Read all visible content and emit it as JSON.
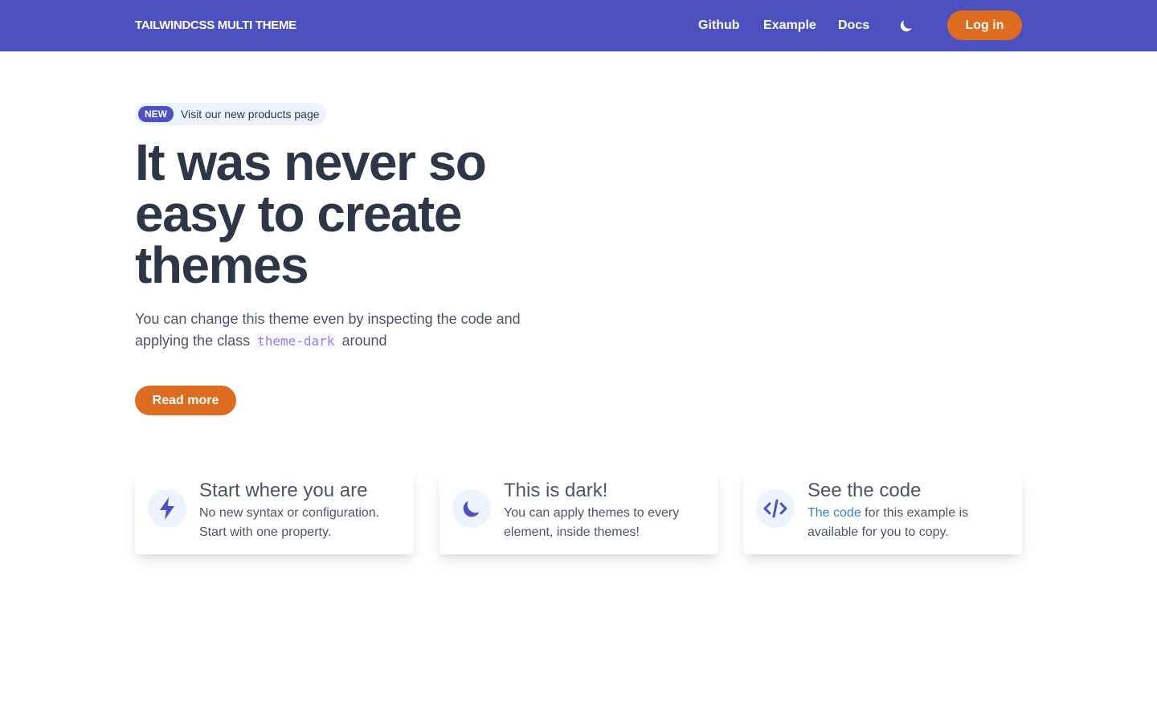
{
  "navbar": {
    "brand": "TAILWINDCSS MULTI THEME",
    "links": [
      "Github",
      "Example",
      "Docs"
    ],
    "theme_toggle_icon": "moon-icon",
    "login_label": "Log in",
    "background": "#4c51bf",
    "accent": "#dd6b20"
  },
  "hero": {
    "badge": "NEW",
    "announcement": "Visit our new products page",
    "title": "It was never so easy to create themes",
    "description_before": "You can change this theme even by inspecting the code and applying the class",
    "code": "theme-dark",
    "description_after": "around",
    "cta_label": "Read more"
  },
  "features": [
    {
      "icon": "lightning-icon",
      "title": "Start where you are",
      "text": "No new syntax or configuration. Start with one property."
    },
    {
      "icon": "moon-icon",
      "title": "This is dark!",
      "text": "You can apply themes to every element, inside themes!"
    },
    {
      "icon": "code-icon",
      "title": "See the code",
      "link_text": "The code",
      "text": "for this example is available for you to copy."
    }
  ]
}
